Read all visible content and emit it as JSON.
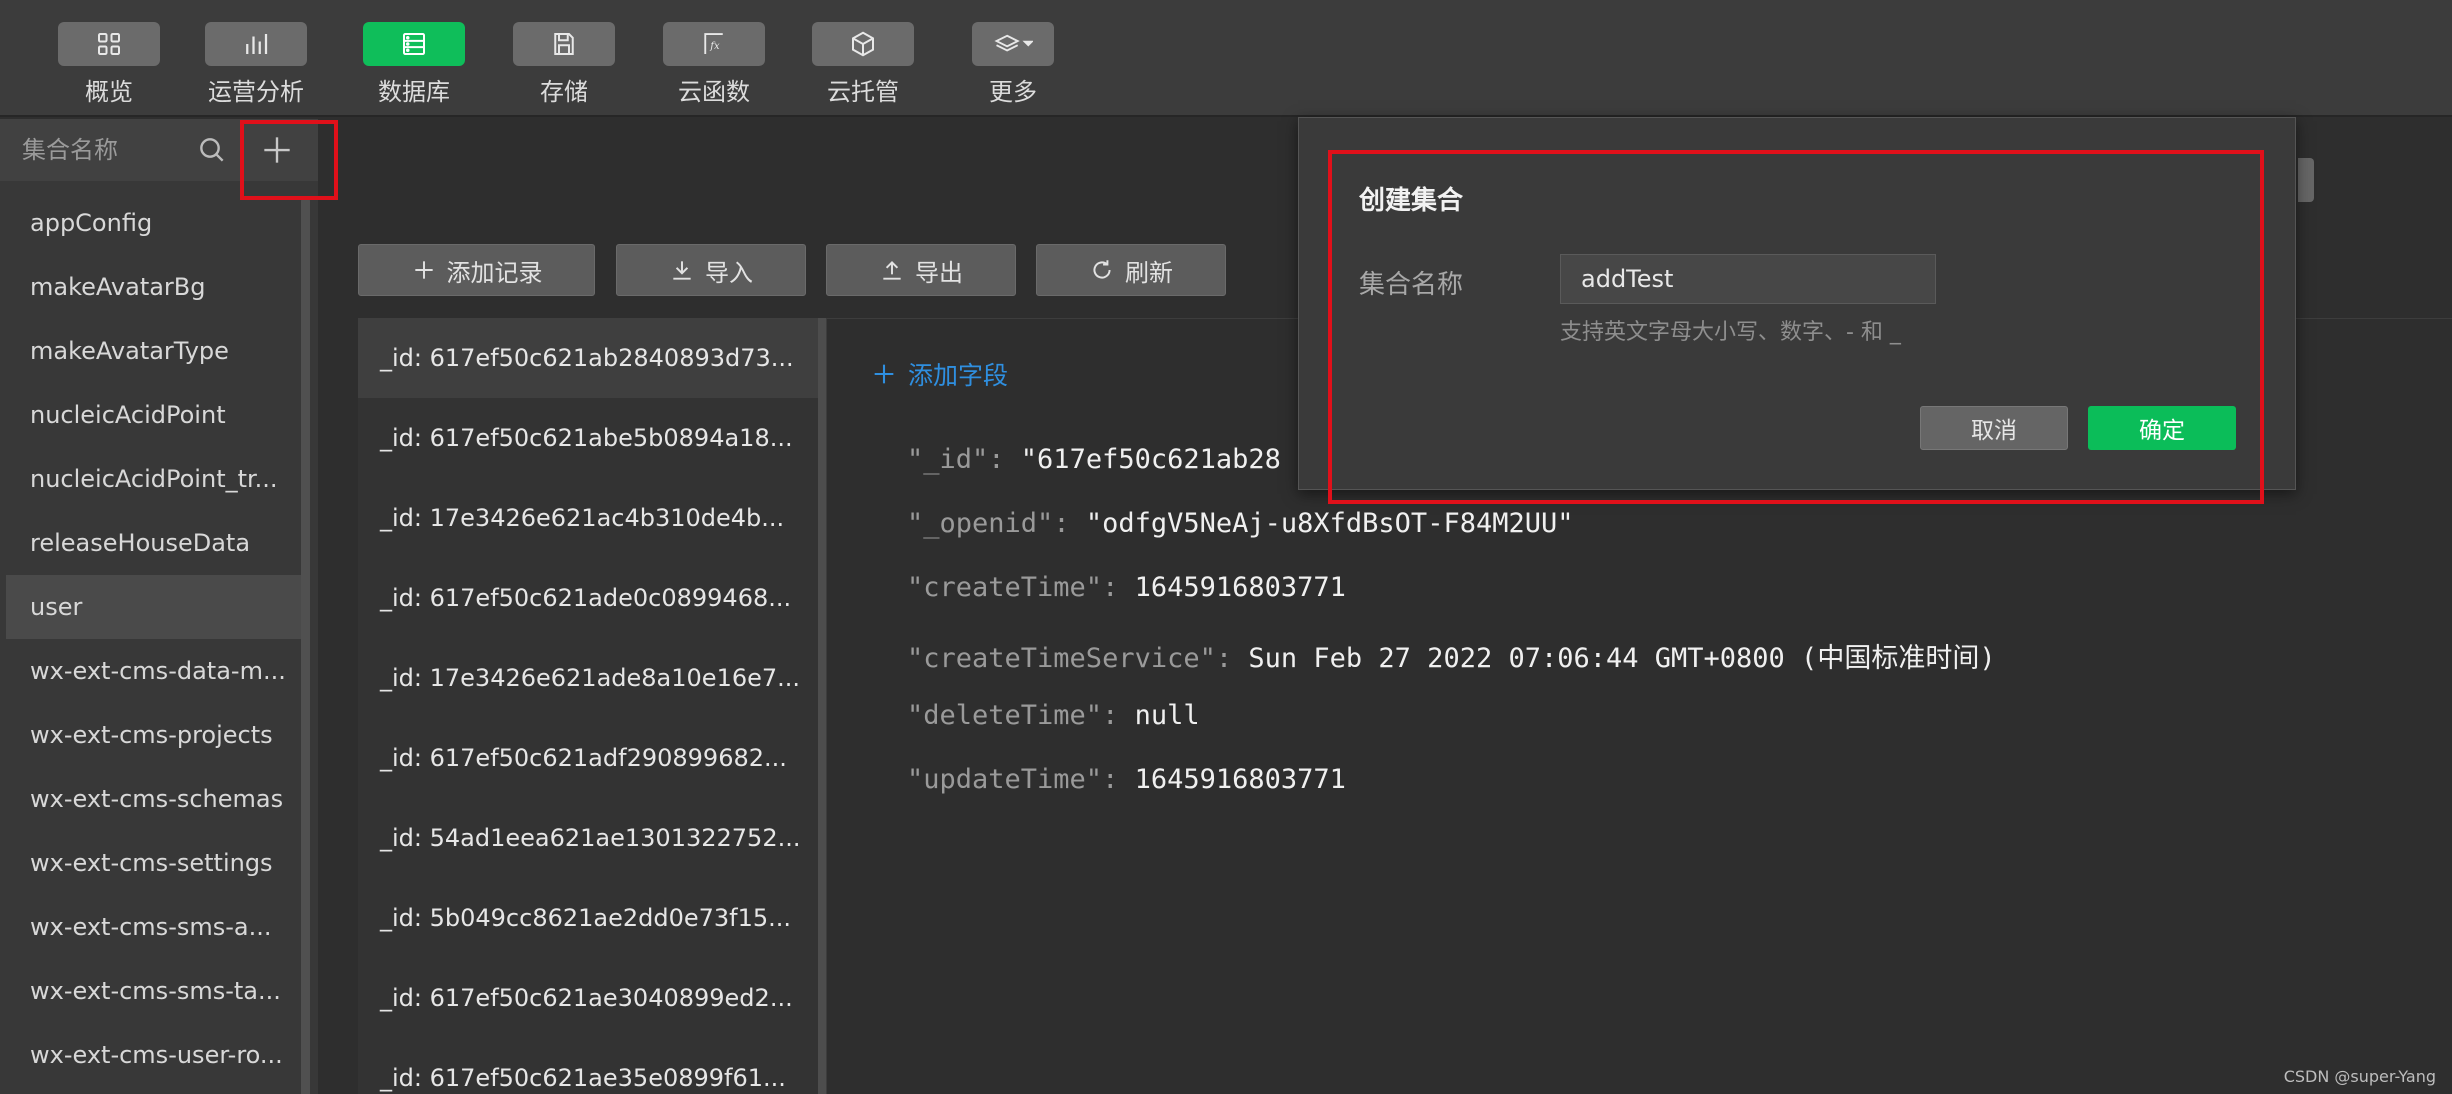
{
  "toolbar": {
    "items": [
      {
        "label": "概览",
        "icon": "overview-grid-icon"
      },
      {
        "label": "运营分析",
        "icon": "bar-chart-icon"
      },
      {
        "label": "数据库",
        "icon": "database-icon",
        "active": true
      },
      {
        "label": "存储",
        "icon": "floppy-disk-icon"
      },
      {
        "label": "云函数",
        "icon": "function-icon"
      },
      {
        "label": "云托管",
        "icon": "cube-icon"
      },
      {
        "label": "更多",
        "icon": "layers-dropdown-icon"
      }
    ]
  },
  "sidebar": {
    "search_placeholder": "集合名称",
    "collections": [
      "appConfig",
      "makeAvatarBg",
      "makeAvatarType",
      "nucleicAcidPoint",
      "nucleicAcidPoint_tr...",
      "releaseHouseData",
      "user",
      "wx-ext-cms-data-m...",
      "wx-ext-cms-projects",
      "wx-ext-cms-schemas",
      "wx-ext-cms-settings",
      "wx-ext-cms-sms-a...",
      "wx-ext-cms-sms-ta...",
      "wx-ext-cms-user-ro..."
    ],
    "selected": "user"
  },
  "actions": {
    "add_record": "添加记录",
    "import": "导入",
    "export": "导出",
    "refresh": "刷新"
  },
  "records": [
    "_id: 617ef50c621ab2840893d73...",
    "_id: 617ef50c621abe5b0894a18...",
    "_id: 17e3426e621ac4b310de4b...",
    "_id: 617ef50c621ade0c0899468...",
    "_id: 17e3426e621ade8a10e16e7...",
    "_id: 617ef50c621adf290899682...",
    "_id: 54ad1eea621ae1301322752...",
    "_id: 5b049cc8621ae2dd0e73f15...",
    "_id: 617ef50c621ae3040899ed2...",
    "_id: 617ef50c621ae35e0899f61..."
  ],
  "detail": {
    "add_field_label": "添加字段",
    "fields": [
      {
        "key": "\"_id\"",
        "value": "\"617ef50c621ab28"
      },
      {
        "key": "\"_openid\"",
        "value": "\"odfgV5NeAj-u8XfdBsOT-F84M2UU\""
      },
      {
        "key": "\"createTime\"",
        "value": "1645916803771"
      },
      {
        "key": "\"createTimeService\"",
        "value": "Sun Feb 27 2022 07:06:44 GMT+0800 (中国标准时间)"
      },
      {
        "key": "\"deleteTime\"",
        "value": "null"
      },
      {
        "key": "\"updateTime\"",
        "value": "1645916803771"
      }
    ]
  },
  "dialog": {
    "title": "创建集合",
    "name_label": "集合名称",
    "name_value": "addTest",
    "hint": "支持英文字母大小写、数字、- 和 _",
    "cancel_label": "取消",
    "ok_label": "确定"
  },
  "colors": {
    "accent_green": "#0fbe5a",
    "link_blue": "#2f8fe0",
    "highlight_red": "#e0101a"
  },
  "watermark": "CSDN @super-Yang"
}
